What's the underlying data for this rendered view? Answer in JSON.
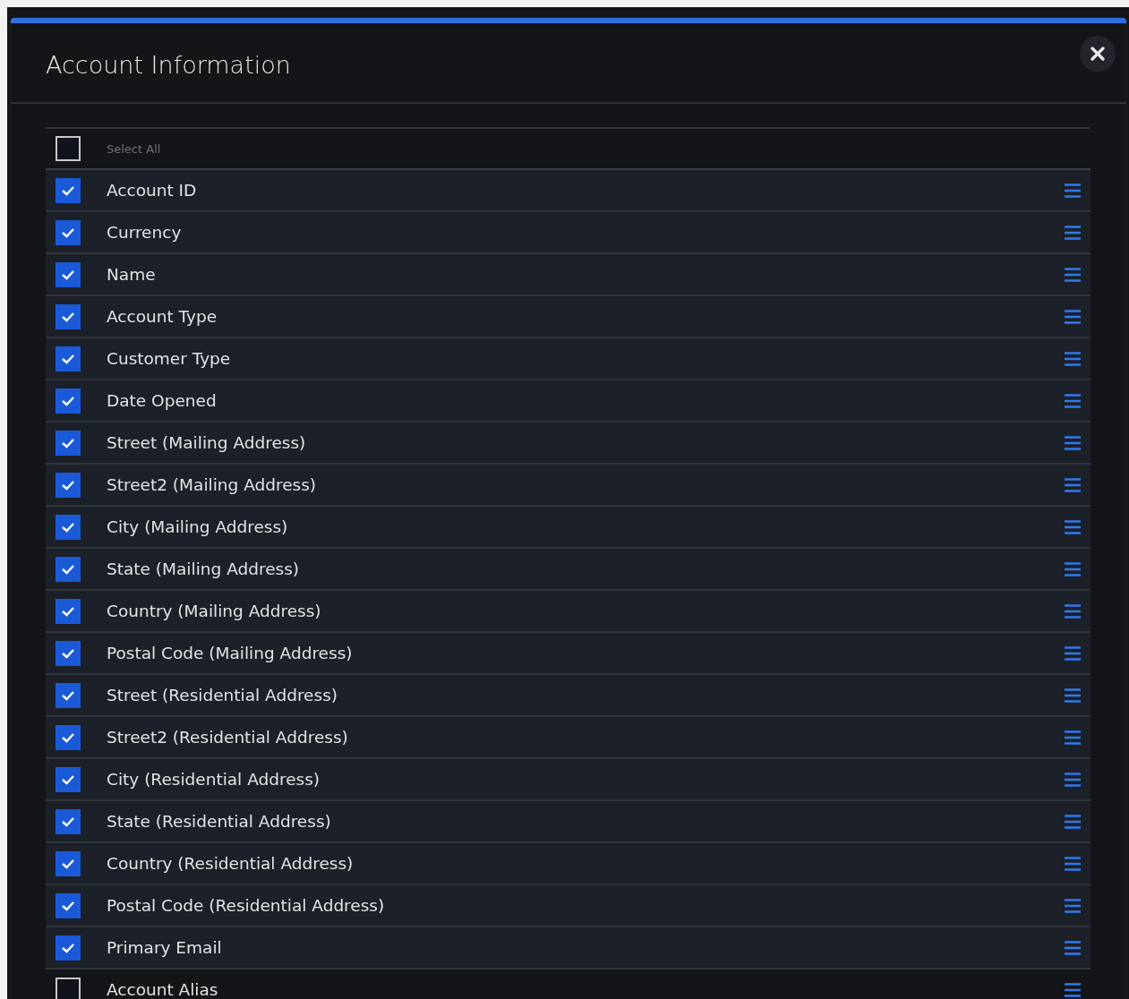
{
  "dialog": {
    "title": "Account Information"
  },
  "select_all": {
    "label": "Select All",
    "checked": false
  },
  "fields": [
    {
      "label": "Account ID",
      "checked": true
    },
    {
      "label": "Currency",
      "checked": true
    },
    {
      "label": "Name",
      "checked": true
    },
    {
      "label": "Account Type",
      "checked": true
    },
    {
      "label": "Customer Type",
      "checked": true
    },
    {
      "label": "Date Opened",
      "checked": true
    },
    {
      "label": "Street (Mailing Address)",
      "checked": true
    },
    {
      "label": "Street2 (Mailing Address)",
      "checked": true
    },
    {
      "label": "City (Mailing Address)",
      "checked": true
    },
    {
      "label": "State (Mailing Address)",
      "checked": true
    },
    {
      "label": "Country (Mailing Address)",
      "checked": true
    },
    {
      "label": "Postal Code (Mailing Address)",
      "checked": true
    },
    {
      "label": "Street (Residential Address)",
      "checked": true
    },
    {
      "label": "Street2 (Residential Address)",
      "checked": true
    },
    {
      "label": "City (Residential Address)",
      "checked": true
    },
    {
      "label": "State (Residential Address)",
      "checked": true
    },
    {
      "label": "Country (Residential Address)",
      "checked": true
    },
    {
      "label": "Postal Code (Residential Address)",
      "checked": true
    },
    {
      "label": "Primary Email",
      "checked": true
    },
    {
      "label": "Account Alias",
      "checked": false
    }
  ]
}
